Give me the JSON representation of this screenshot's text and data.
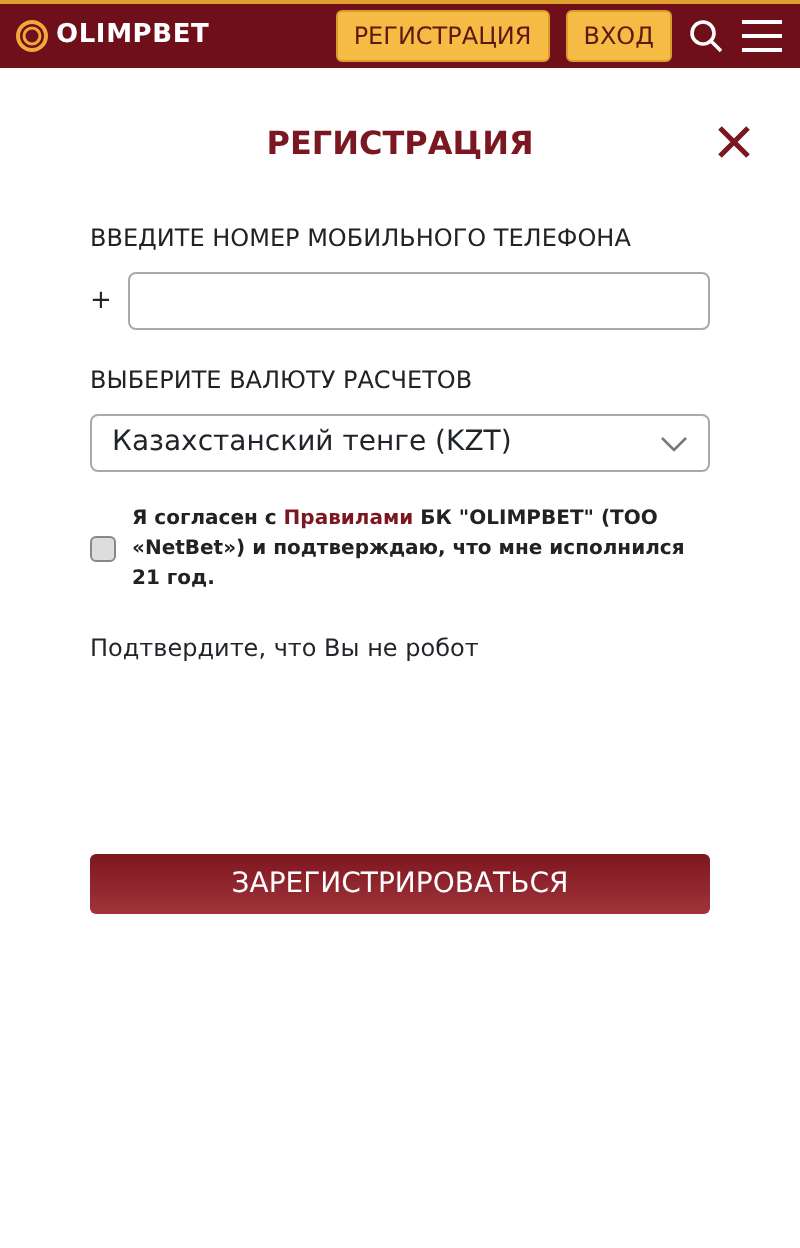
{
  "header": {
    "logo": "OLIMPBET",
    "buttons": [
      "РЕГИСТРАЦИЯ",
      "ВХОД"
    ]
  },
  "form": {
    "title": "РЕГИСТРАЦИЯ",
    "phone": {
      "label": "ВВЕДИТЕ НОМЕР МОБИЛЬНОГО ТЕЛЕФОНА",
      "prefix": "+"
    },
    "currency": {
      "label": "ВЫБЕРИТЕ ВАЛЮТУ РАСЧЕТОВ",
      "value": "Казахстанский тенге (KZT)"
    },
    "agreement": {
      "checked": false,
      "before": "Я согласен с",
      "link": "Правилами",
      "after": "БК \"OLIMPBET\" (ТОО «NetBet») и подтверждаю, что мне исполнился 21 год."
    },
    "captcha_text": "Подтвердите, что Вы не робот",
    "submit": "ЗАРЕГИСТРИРОВАТЬСЯ"
  }
}
